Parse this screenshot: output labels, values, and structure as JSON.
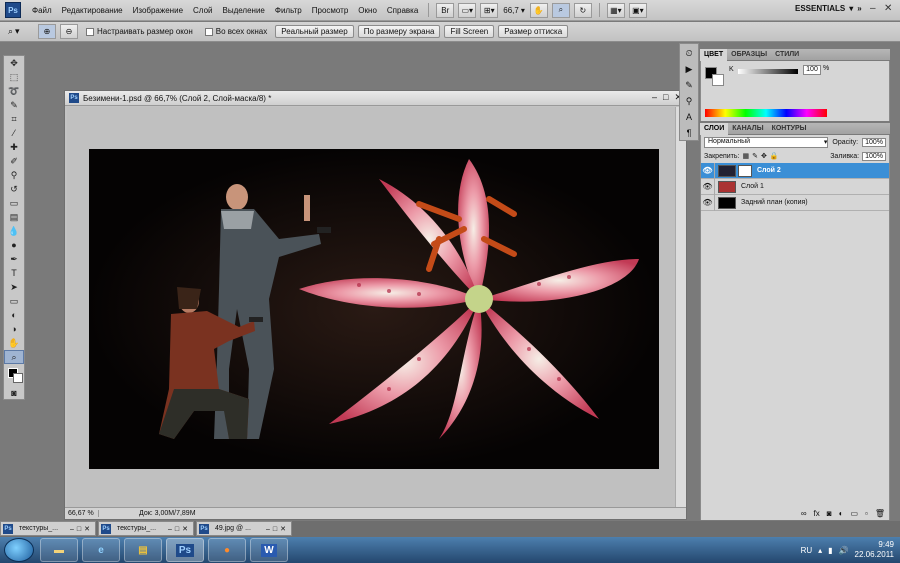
{
  "menubar": {
    "app_icon": "Ps",
    "items": [
      "Файл",
      "Редактирование",
      "Изображение",
      "Слой",
      "Выделение",
      "Фильтр",
      "Просмотр",
      "Окно",
      "Справка"
    ],
    "bridge_label": "Br",
    "zoom": "66,7",
    "workspace": "ESSENTIALS"
  },
  "options": {
    "resize_windows": "Настраивать размер окон",
    "all_windows": "Во всех окнах",
    "actual_pixels": "Реальный размер",
    "fit_screen": "По размеру экрана",
    "fill_screen": "Fill Screen",
    "print_size": "Размер оттиска"
  },
  "document": {
    "title": "Безимени-1.psd @ 66,7% (Слой 2, Слой-маска/8) *",
    "zoom": "66,67 %",
    "doc_info": "Док: 3,00M/7,89M"
  },
  "color_panel": {
    "tabs": [
      "ЦВЕТ",
      "ОБРАЗЦЫ",
      "СТИЛИ"
    ],
    "channel": "K",
    "value": "100",
    "unit": "%"
  },
  "layers_panel": {
    "tabs": [
      "СЛОИ",
      "КАНАЛЫ",
      "КОНТУРЫ"
    ],
    "blend_mode": "Нормальный",
    "opacity_label": "Opacity:",
    "opacity": "100%",
    "lock_label": "Закрепить:",
    "fill_label": "Заливка:",
    "fill": "100%",
    "layers": [
      {
        "name": "Слой 2",
        "selected": true
      },
      {
        "name": "Слой 1",
        "selected": false
      },
      {
        "name": "Задний план (копия)",
        "selected": false
      }
    ]
  },
  "doc_strip": [
    {
      "title": "текстуры_..."
    },
    {
      "title": "текстуры_..."
    },
    {
      "title": "49.jpg @ ..."
    }
  ],
  "taskbar": {
    "apps": [
      "folder",
      "ie",
      "winrar",
      "photoshop",
      "firefox",
      "word"
    ],
    "lang": "RU",
    "time": "9:49",
    "date": "22.06.2011"
  }
}
